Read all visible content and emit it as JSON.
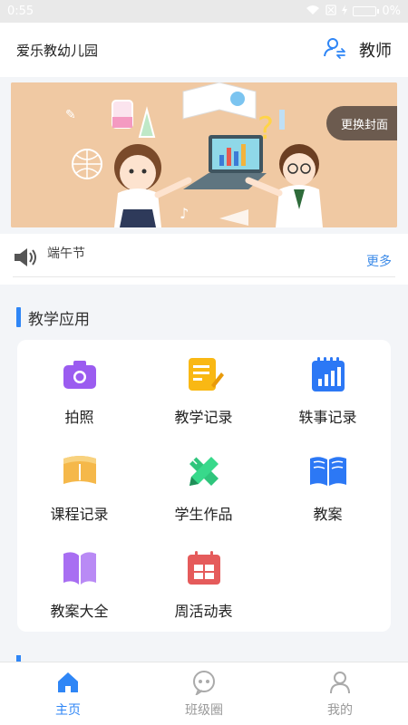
{
  "status": {
    "time": "0:55",
    "battery": "0%"
  },
  "header": {
    "school": "爱乐教幼儿园",
    "role": "教师"
  },
  "banner": {
    "change_cover": "更换封面"
  },
  "notice": {
    "text": "端午节",
    "more": "更多"
  },
  "teaching": {
    "title": "教学应用",
    "apps": [
      {
        "label": "拍照",
        "icon": "camera-icon"
      },
      {
        "label": "教学记录",
        "icon": "notepad-pencil-icon"
      },
      {
        "label": "轶事记录",
        "icon": "bar-chart-notebook-icon"
      },
      {
        "label": "课程记录",
        "icon": "book-icon"
      },
      {
        "label": "学生作品",
        "icon": "pencil-ruler-icon"
      },
      {
        "label": "教案",
        "icon": "open-book-icon"
      },
      {
        "label": "教案大全",
        "icon": "book-collection-icon"
      },
      {
        "label": "周活动表",
        "icon": "calendar-icon"
      }
    ]
  },
  "tabs": [
    {
      "label": "主页",
      "icon": "home-icon",
      "active": true
    },
    {
      "label": "班级圈",
      "icon": "chat-bubble-icon",
      "active": false
    },
    {
      "label": "我的",
      "icon": "user-icon",
      "active": false
    }
  ],
  "colors": {
    "accent": "#2f86f6",
    "camera": "#9b5cf0",
    "notepad": "#f9b814",
    "chart": "#2c78f5",
    "book": "#f5b84a",
    "pencil": "#2fc57c",
    "openbook": "#2c78f5",
    "collection": "#a86ef2",
    "calendar": "#e55b5b"
  }
}
